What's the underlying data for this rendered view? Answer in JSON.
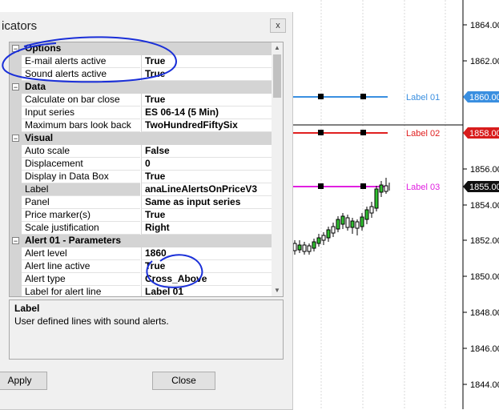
{
  "dialog": {
    "title": "icators",
    "close_glyph": "x",
    "apply_label": "Apply",
    "close_label": "Close",
    "categories": [
      {
        "label": "Options",
        "toggle": "−"
      },
      {
        "label": "Data",
        "toggle": "−"
      },
      {
        "label": "Visual",
        "toggle": "−"
      },
      {
        "label": "Alert 01 - Parameters",
        "toggle": "−"
      }
    ],
    "options": [
      {
        "name": "E-mail alerts active",
        "value": "True"
      },
      {
        "name": "Sound alerts active",
        "value": "True"
      }
    ],
    "data_rows": [
      {
        "name": "Calculate on bar close",
        "value": "True"
      },
      {
        "name": "Input series",
        "value": "ES 06-14 (5 Min)"
      },
      {
        "name": "Maximum bars look back",
        "value": "TwoHundredFiftySix"
      }
    ],
    "visual_rows": [
      {
        "name": "Auto scale",
        "value": "False"
      },
      {
        "name": "Displacement",
        "value": "0"
      },
      {
        "name": "Display in Data Box",
        "value": "True"
      },
      {
        "name": "Label",
        "value": "anaLineAlertsOnPriceV3"
      },
      {
        "name": "Panel",
        "value": "Same as input series"
      },
      {
        "name": "Price marker(s)",
        "value": "True"
      },
      {
        "name": "Scale justification",
        "value": "Right"
      }
    ],
    "alert_rows": [
      {
        "name": "Alert level",
        "value": "1860"
      },
      {
        "name": "Alert line active",
        "value": "True"
      },
      {
        "name": "Alert type",
        "value": "Cross_Above"
      },
      {
        "name": "Label for alert line",
        "value": "Label 01"
      }
    ],
    "description": {
      "title": "Label",
      "text": "User defined lines with sound alerts."
    }
  },
  "chart": {
    "price_axis_ticks": [
      "1864.00",
      "1862.00",
      "1860.00",
      "1858.00",
      "1856.00",
      "1855.00",
      "1854.00",
      "1852.00",
      "1850.00",
      "1848.00",
      "1846.00",
      "1844.00"
    ],
    "alert_lines": [
      {
        "label": "Label 01",
        "price": "1860.00",
        "color": "#3a8fe0"
      },
      {
        "label": "Label 02",
        "price": "1858.00",
        "color": "#e02020"
      },
      {
        "label": "Label 03",
        "price": "1855.00",
        "color": "#e020e0"
      }
    ]
  }
}
